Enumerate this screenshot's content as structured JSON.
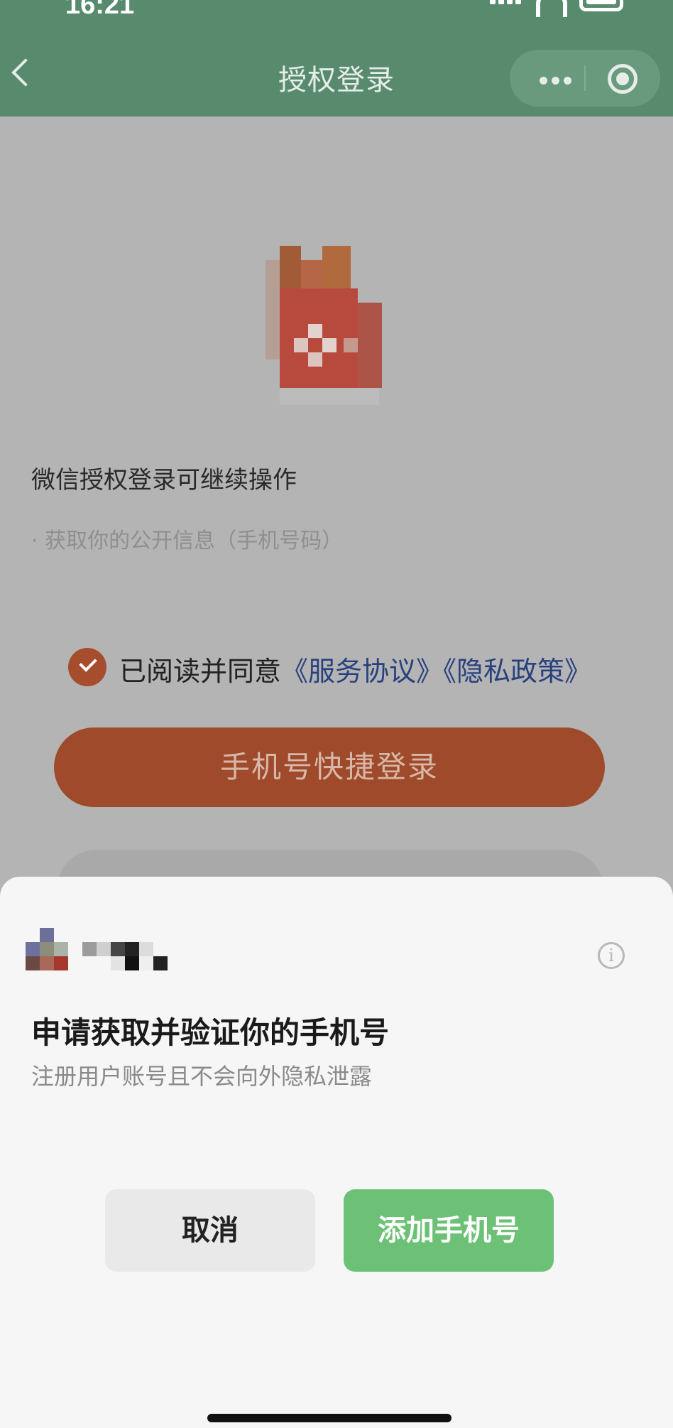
{
  "status_bar": {
    "time": "16:21"
  },
  "nav": {
    "title": "授权登录"
  },
  "intro": {
    "title": "微信授权登录可继续操作",
    "item": "· 获取你的公开信息（手机号码）"
  },
  "agreement": {
    "prefix": "已阅读并同意",
    "service_link": "《服务协议》",
    "privacy_link": "《隐私政策》"
  },
  "login_button": "手机号快捷登录",
  "sheet": {
    "title": "申请获取并验证你的手机号",
    "subtitle": "注册用户账号且不会向外隐私泄露",
    "info_icon": "i",
    "cancel_label": "取消",
    "add_phone_label": "添加手机号"
  },
  "colors": {
    "nav_green": "#588a6e",
    "brand_orange": "#9f4a2b",
    "link_blue": "#29407e",
    "confirm_green": "#6cc176"
  }
}
